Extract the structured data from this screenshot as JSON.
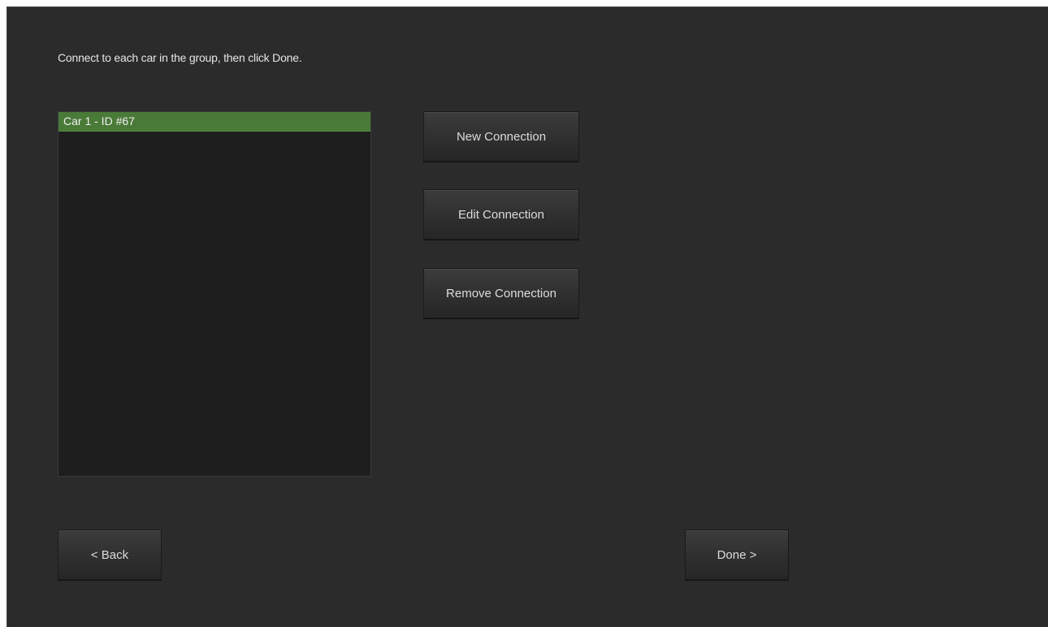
{
  "instruction": "Connect to each car in the group, then click Done.",
  "connections": {
    "items": [
      {
        "label": "Car 1 - ID #67",
        "selected": true
      }
    ]
  },
  "actions": {
    "new_label": "New Connection",
    "edit_label": "Edit Connection",
    "remove_label": "Remove Connection"
  },
  "navigation": {
    "back_label": "< Back",
    "done_label": "Done >"
  },
  "colors": {
    "background": "#2b2b2b",
    "list_background": "#1e1e1e",
    "selection": "#4a7a38"
  }
}
